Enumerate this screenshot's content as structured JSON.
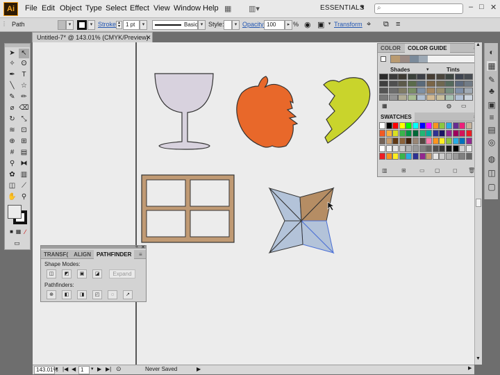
{
  "menubar": {
    "logo": "Ai",
    "items": [
      "File",
      "Edit",
      "Object",
      "Type",
      "Select",
      "Effect",
      "View",
      "Window",
      "Help"
    ],
    "workspace": "ESSENTIALS"
  },
  "controlbar": {
    "selection": "Path",
    "stroke_label": "Stroke:",
    "stroke_value": "1 pt",
    "brush_label": "Basic",
    "style_label": "Style:",
    "opacity_label": "Opacity:",
    "opacity_value": "100",
    "percent": "%",
    "transform_label": "Transform"
  },
  "document": {
    "tab_title": "Untitled-7* @ 143.01% (CMYK/Preview)"
  },
  "color_panel": {
    "tab_color": "COLOR",
    "tab_guide": "COLOR GUIDE",
    "shades_label": "Shades",
    "tints_label": "Tints",
    "swatches_tab": "SWATCHES"
  },
  "pathfinder": {
    "tab_transform": "TRANSF(",
    "tab_align": "ALIGN",
    "tab_pathfinder": "PATHFINDER",
    "shape_modes_label": "Shape Modes:",
    "pathfinders_label": "Pathfinders:",
    "expand_label": "Expand"
  },
  "statusbar": {
    "zoom": "143.01%",
    "page": "1",
    "status": "Never Saved"
  },
  "colors": {
    "glass": "#d8d2de",
    "apple": "#e8682a",
    "heart": "#c9d42c",
    "window_frame": "#c09a74",
    "star_blue": "#b3c3d9",
    "star_tan": "#b58d64"
  }
}
